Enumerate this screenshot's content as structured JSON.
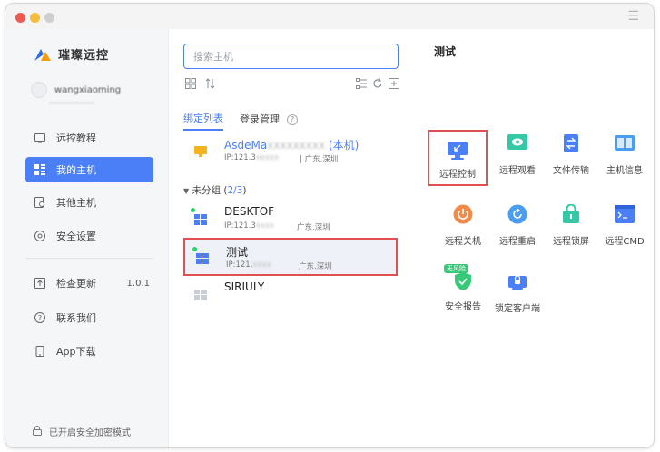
{
  "window": {
    "menu_glyph": "☰"
  },
  "sidebar": {
    "logo_text": "璀璨远控",
    "user_name": "wangxiaoming",
    "items": [
      {
        "label": "远控教程",
        "icon": "tutorial-icon"
      },
      {
        "label": "我的主机",
        "icon": "grid-icon",
        "active": true
      },
      {
        "label": "其他主机",
        "icon": "other-hosts-icon"
      },
      {
        "label": "安全设置",
        "icon": "security-settings-icon"
      },
      {
        "label": "检查更新",
        "icon": "update-icon",
        "version": "1.0.1"
      },
      {
        "label": "联系我们",
        "icon": "help-icon"
      },
      {
        "label": "App下载",
        "icon": "phone-icon"
      }
    ],
    "bottom_note": "已开启安全加密模式"
  },
  "middle": {
    "search_placeholder": "搜索主机",
    "tabs": [
      {
        "label": "绑定列表",
        "active": true
      },
      {
        "label": "登录管理",
        "active": false
      }
    ],
    "help_glyph": "?",
    "local_host": {
      "name": "AsdeMa",
      "suffix": "(本机)",
      "ip": "IP:121.3",
      "location": "| 广东.深圳"
    },
    "group": {
      "label": "未分组",
      "count": "2/3",
      "open": "(",
      "close": ")"
    },
    "hosts": [
      {
        "name": "DESKTOF",
        "ip": "IP:121.3",
        "location": "广东.深圳",
        "online": true
      },
      {
        "name": "测试",
        "ip": "IP:121.",
        "location": "广东.深圳",
        "online": true,
        "selected": true
      },
      {
        "name": "SIRIULY",
        "ip": "",
        "location": "",
        "online": false
      }
    ]
  },
  "right": {
    "title": "测试",
    "functions": [
      {
        "label": "远程控制",
        "icon": "remote-control-icon",
        "highlight": true
      },
      {
        "label": "远程观看",
        "icon": "remote-view-icon"
      },
      {
        "label": "文件传输",
        "icon": "file-transfer-icon"
      },
      {
        "label": "主机信息",
        "icon": "host-info-icon"
      },
      {
        "label": "远程关机",
        "icon": "power-icon"
      },
      {
        "label": "远程重启",
        "icon": "restart-icon"
      },
      {
        "label": "远程锁屏",
        "icon": "lock-screen-icon"
      },
      {
        "label": "远程CMD",
        "icon": "cmd-icon"
      },
      {
        "label": "安全报告",
        "icon": "shield-icon",
        "badge": "无风险"
      },
      {
        "label": "锁定客户端",
        "icon": "lock-client-icon"
      }
    ]
  },
  "colors": {
    "accent": "#4a7ff7",
    "highlight_border": "#e05053",
    "online": "#2fcf72"
  }
}
